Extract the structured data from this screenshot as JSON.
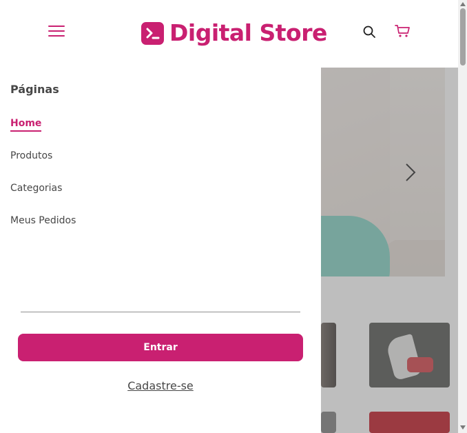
{
  "header": {
    "brand": "Digital Store",
    "logo_glyph": ">_",
    "icons": [
      "menu-icon",
      "search-icon",
      "cart-icon"
    ]
  },
  "drawer": {
    "title": "Páginas",
    "items": [
      {
        "label": "Home",
        "active": true
      },
      {
        "label": "Produtos",
        "active": false
      },
      {
        "label": "Categorias",
        "active": false
      },
      {
        "label": "Meus Pedidos",
        "active": false
      }
    ],
    "login_label": "Entrar",
    "signup_label": "Cadastre-se"
  },
  "colors": {
    "primary": "#c92071",
    "text": "#474747",
    "overlay": "rgba(110,110,110,0.45)"
  }
}
